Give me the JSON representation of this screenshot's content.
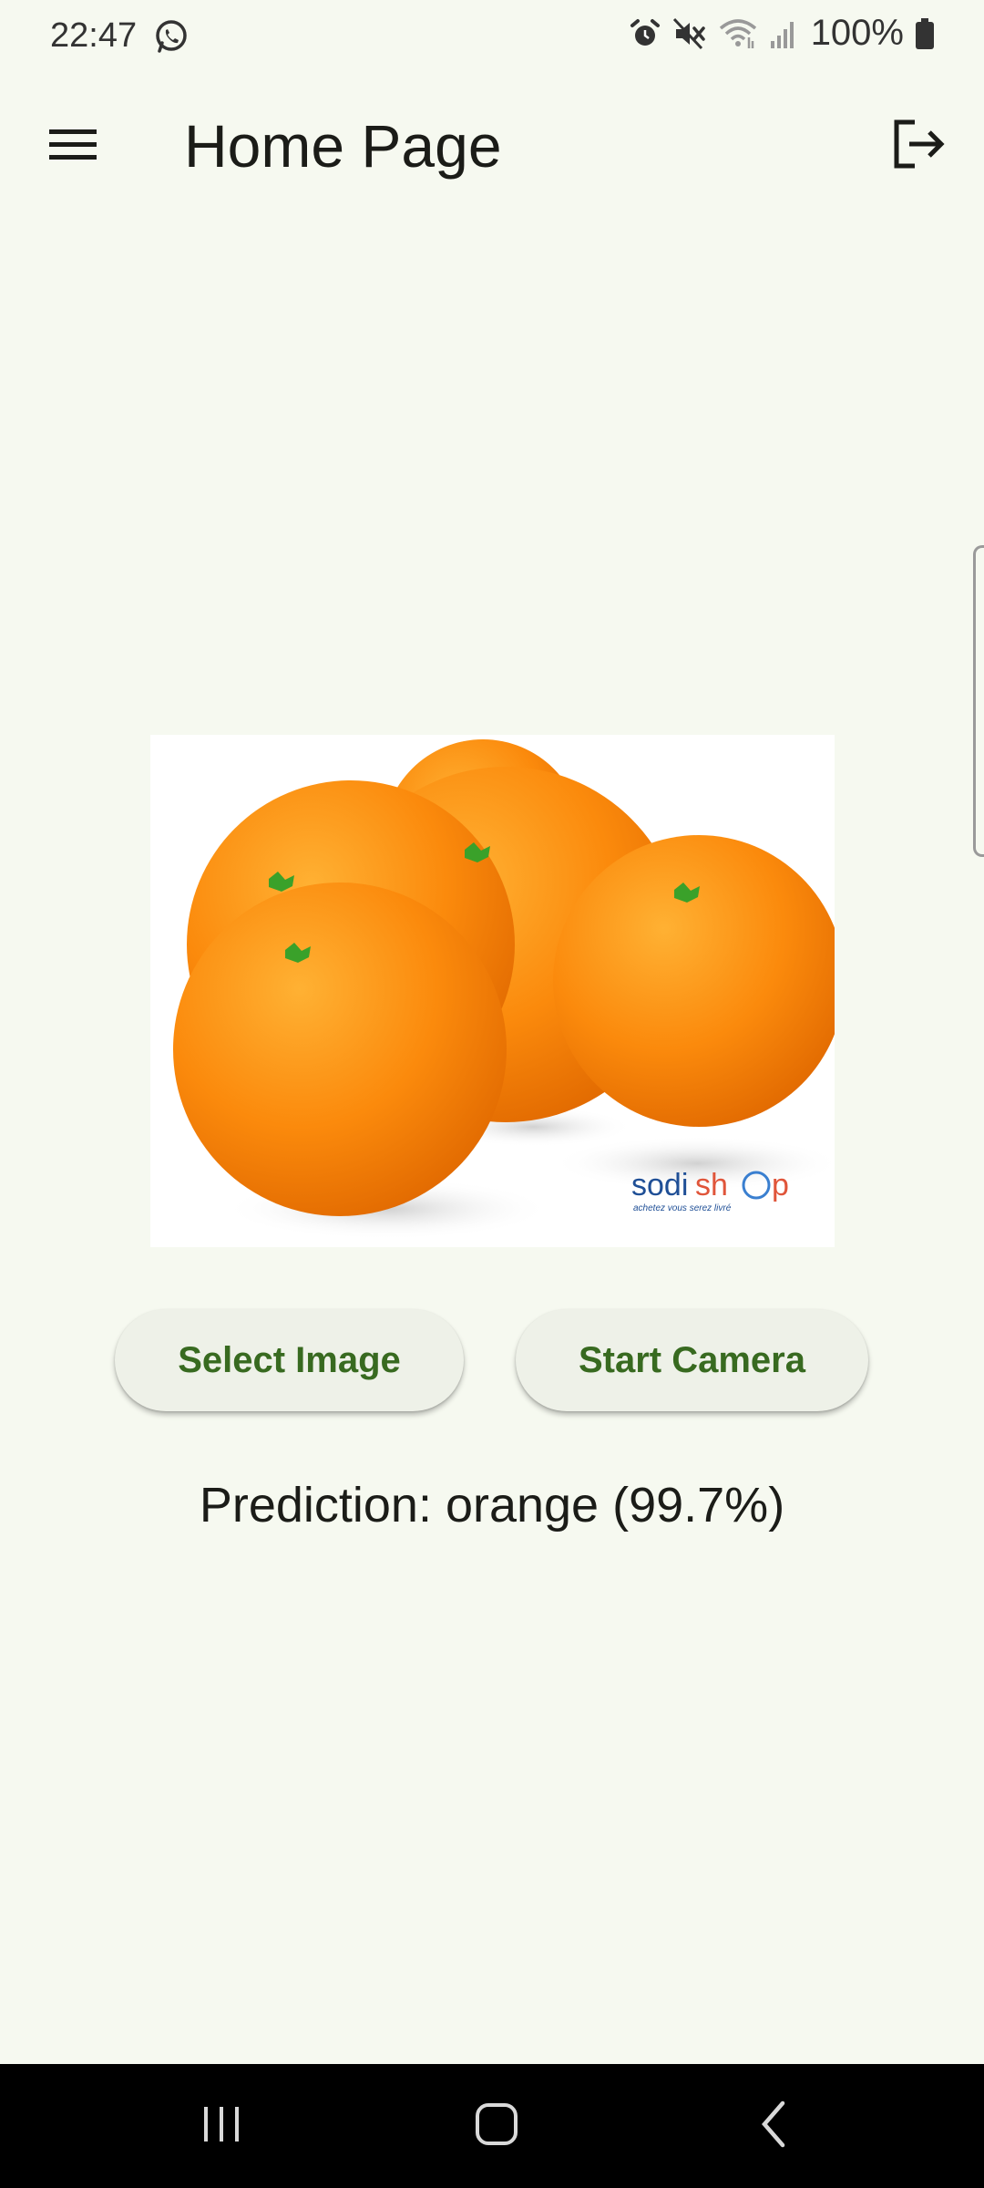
{
  "status_bar": {
    "time": "22:47",
    "battery": "100%",
    "icons": [
      "whatsapp-icon",
      "alarm-icon",
      "mute-icon",
      "wifi-icon",
      "signal-icon",
      "battery-icon"
    ]
  },
  "app_bar": {
    "title": "Home Page",
    "menu_icon": "menu-icon",
    "logout_icon": "logout-icon"
  },
  "preview": {
    "watermark_brand_a": "sodi",
    "watermark_brand_b": "sh",
    "watermark_brand_c": "p",
    "watermark_tagline": "achetez vous serez livré"
  },
  "actions": {
    "select_image_label": "Select Image",
    "start_camera_label": "Start Camera"
  },
  "result": {
    "prediction_text": "Prediction: orange (99.7%)"
  },
  "colors": {
    "background": "#f6f9f0",
    "button_text": "#386a20",
    "button_bg": "#eef1e8"
  },
  "nav_bar": {
    "icons": [
      "recent-apps-icon",
      "home-icon",
      "back-icon"
    ]
  }
}
